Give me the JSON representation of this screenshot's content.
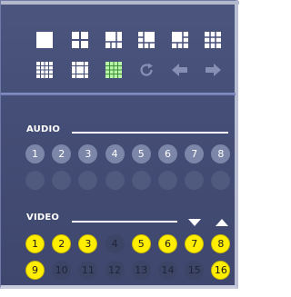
{
  "toolbar": {
    "row1": [
      "layout-1x1-icon",
      "layout-2x2-icon",
      "layout-1-plus-3-icon",
      "layout-3x3-alt-icon",
      "layout-1-plus-5-icon",
      "layout-3x3-icon"
    ],
    "row2": [
      "layout-4x4-icon",
      "layout-1-plus-7-icon",
      "layout-4x4-selected-icon",
      "refresh-icon",
      "previous-arrow-icon",
      "next-arrow-icon"
    ],
    "selected": "layout-4x4-selected-icon"
  },
  "audio": {
    "title": "AUDIO",
    "row1": [
      "1",
      "2",
      "3",
      "4",
      "5",
      "6",
      "7",
      "8"
    ],
    "row2": [
      "",
      "",
      "",
      "",
      "",
      "",
      "",
      ""
    ]
  },
  "video": {
    "title": "VIDEO",
    "row1": [
      {
        "label": "1",
        "active": true
      },
      {
        "label": "2",
        "active": true
      },
      {
        "label": "3",
        "active": true
      },
      {
        "label": "4",
        "active": false
      },
      {
        "label": "5",
        "active": true
      },
      {
        "label": "6",
        "active": true
      },
      {
        "label": "7",
        "active": true
      },
      {
        "label": "8",
        "active": true
      }
    ],
    "row2": [
      {
        "label": "9",
        "active": true
      },
      {
        "label": "10",
        "active": false
      },
      {
        "label": "11",
        "active": false
      },
      {
        "label": "12",
        "active": false
      },
      {
        "label": "13",
        "active": false
      },
      {
        "label": "14",
        "active": false
      },
      {
        "label": "15",
        "active": false
      },
      {
        "label": "16",
        "active": true
      }
    ],
    "scroll_down_icon": "arrow-down-icon",
    "scroll_up_icon": "arrow-up-icon"
  },
  "colors": {
    "panel_bg": "#464f78",
    "separator": "#7a84c0",
    "active_channel": "#ffee00",
    "inactive_channel": "#3d4566",
    "audio_channel": "#7b86a8"
  }
}
